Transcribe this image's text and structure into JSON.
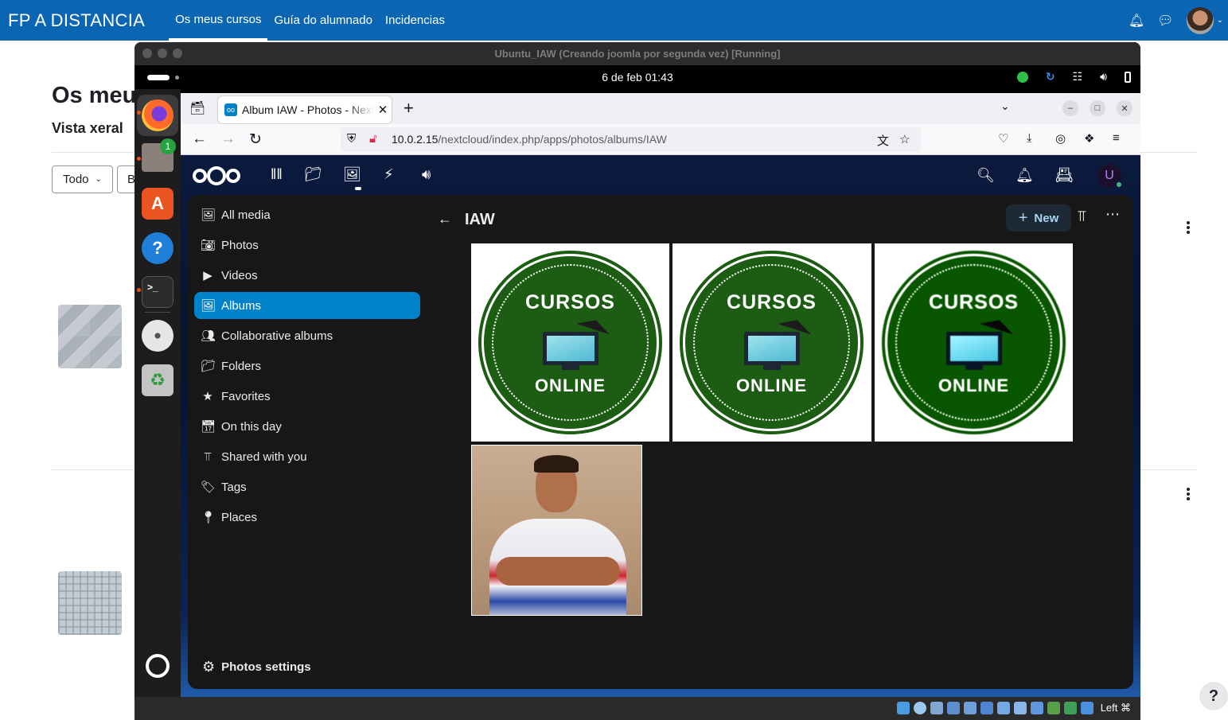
{
  "moodle": {
    "brand": "FP A DISTANCIA",
    "nav": [
      "Os meus cursos",
      "Guía do alumnado",
      "Incidencias"
    ],
    "page_title": "Os meu",
    "subtitle": "Vista xeral",
    "filter_value": "Todo",
    "filter2_value": "B",
    "help_label": "?"
  },
  "vbox": {
    "title": "Ubuntu_IAW (Creando joomla por segunda vez) [Running]",
    "host_key": "Left ⌘"
  },
  "gnome": {
    "clock": "6 de feb  01:43"
  },
  "dock": {
    "files_badge": "1"
  },
  "firefox": {
    "tab_title": "Album IAW - Photos - Nextcloud",
    "url_host": "10.0.2.15",
    "url_path": "/nextcloud/index.php/apps/photos/albums/IAW"
  },
  "nextcloud": {
    "nav": [
      {
        "icon": "image-icon",
        "label": "All media"
      },
      {
        "icon": "camera-icon",
        "label": "Photos"
      },
      {
        "icon": "video-icon",
        "label": "Videos"
      },
      {
        "icon": "album-icon",
        "label": "Albums"
      },
      {
        "icon": "users-icon",
        "label": "Collaborative albums"
      },
      {
        "icon": "folder-icon",
        "label": "Folders"
      },
      {
        "icon": "star-icon",
        "label": "Favorites"
      },
      {
        "icon": "calendar-icon",
        "label": "On this day"
      },
      {
        "icon": "share-icon",
        "label": "Shared with you"
      },
      {
        "icon": "tag-icon",
        "label": "Tags"
      },
      {
        "icon": "map-pin-icon",
        "label": "Places"
      }
    ],
    "active_nav": "Albums",
    "settings_label": "Photos settings",
    "user_initial": "U",
    "album_title": "IAW",
    "new_button": "New",
    "badge_top": "CURSOS",
    "badge_bottom": "ONLINE"
  }
}
